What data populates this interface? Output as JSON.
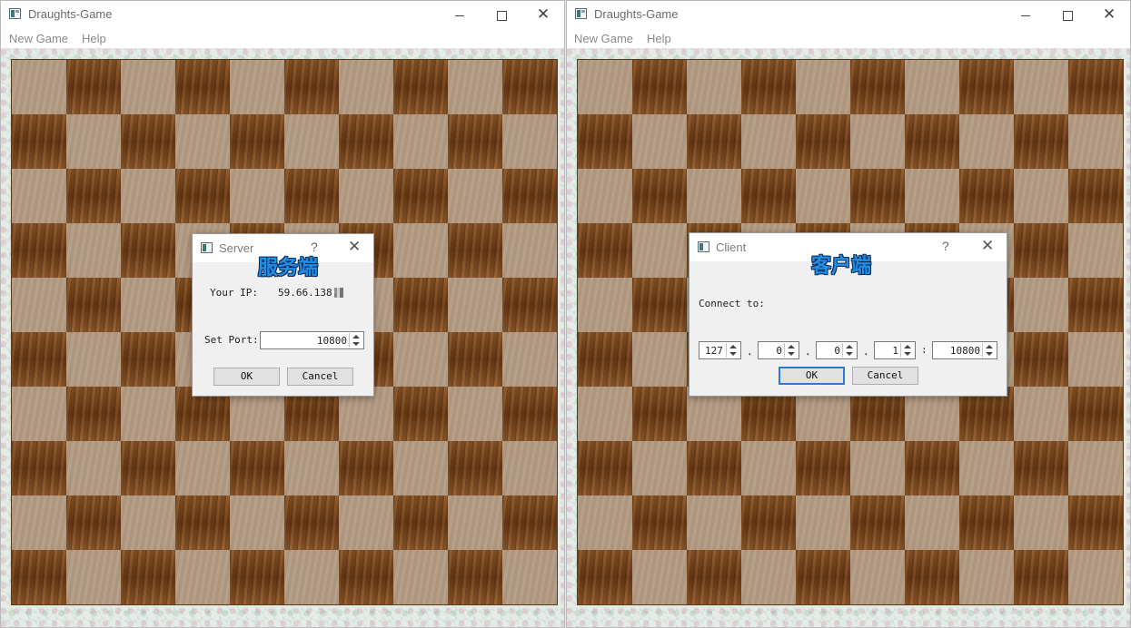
{
  "left_window": {
    "title": "Draughts-Game",
    "menu": [
      "New Game",
      "Help"
    ],
    "dialog": {
      "title": "Server",
      "overlay_label": "服务端",
      "help": "?",
      "ip_label": "Your IP:",
      "ip_value": "59.66.138.",
      "port_label": "Set Port:",
      "port_value": "10800",
      "ok_label": "OK",
      "cancel_label": "Cancel"
    }
  },
  "right_window": {
    "title": "Draughts-Game",
    "menu": [
      "New Game",
      "Help"
    ],
    "dialog": {
      "title": "Client",
      "overlay_label": "客户端",
      "help": "?",
      "connect_label": "Connect to:",
      "ip_parts": [
        "127",
        "0",
        "0",
        "1"
      ],
      "port_value": "10800",
      "dot": ".",
      "colon": ":",
      "ok_label": "OK",
      "cancel_label": "Cancel"
    }
  },
  "colors": {
    "light_square": "#b39a82",
    "dark_square": "#7a4620",
    "default_button_border": "#2b7bd6",
    "overlay_label": "#1e8fe6"
  }
}
